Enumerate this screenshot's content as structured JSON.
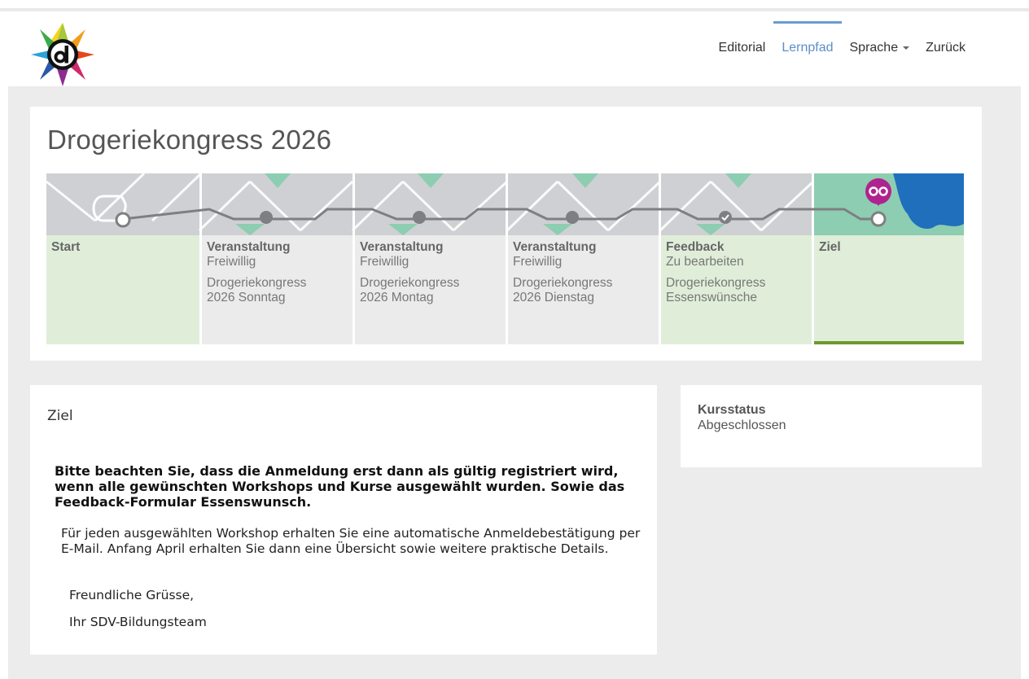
{
  "nav": {
    "items": [
      {
        "label": "Editorial",
        "active": false
      },
      {
        "label": "Lernpfad",
        "active": true
      },
      {
        "label": "Sprache",
        "dropdown": true
      },
      {
        "label": "Zurück",
        "active": false
      }
    ]
  },
  "course": {
    "title": "Drogeriekongress 2026",
    "steps": [
      {
        "title": "Start",
        "status": "",
        "description": ""
      },
      {
        "title": "Veranstaltung",
        "status": "Freiwillig",
        "description": "Drogeriekongress 2026 Sonntag"
      },
      {
        "title": "Veranstaltung",
        "status": "Freiwillig",
        "description": "Drogeriekongress 2026 Montag"
      },
      {
        "title": "Veranstaltung",
        "status": "Freiwillig",
        "description": "Drogeriekongress 2026 Dienstag"
      },
      {
        "title": "Feedback",
        "status": "Zu bearbeiten",
        "description": "Drogeriekongress Essenswünsche"
      },
      {
        "title": "Ziel",
        "status": "",
        "description": ""
      }
    ]
  },
  "content": {
    "heading": "Ziel",
    "bold_note": "Bitte beachten Sie, dass die Anmeldung erst dann als gültig registriert wird, wenn alle gewünschten Workshops und Kurse ausgewählt wurden. Sowie das Feedback-Formular Essenswunsch.",
    "info": "Für jeden ausgewählten Workshop erhalten Sie eine automatische Anmeldebestätigung per E-Mail. Anfang April erhalten Sie dann eine Übersicht sowie weitere praktische Details.",
    "greeting": "Freundliche Grüsse,",
    "signature": "Ihr SDV-Bildungsteam"
  },
  "status": {
    "label": "Kursstatus",
    "value": "Abgeschlossen"
  },
  "colors": {
    "accent": "#5b8fc9",
    "complete_green": "#6c9a2d",
    "map_green": "#8dcdb1",
    "map_blue": "#1f6fbd",
    "marker_magenta": "#b0238f"
  }
}
